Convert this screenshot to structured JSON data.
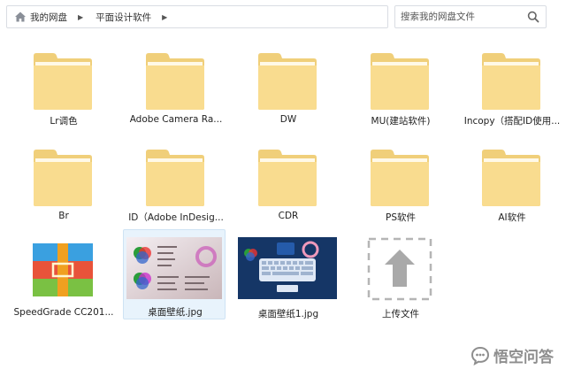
{
  "breadcrumb": {
    "home_icon": "home-icon",
    "items": [
      "我的网盘",
      "平面设计软件"
    ]
  },
  "search": {
    "placeholder": "搜索我的网盘文件",
    "icon": "search-icon"
  },
  "files": [
    {
      "name": "Lr调色",
      "type": "folder"
    },
    {
      "name": "Adobe Camera Ra...",
      "type": "folder"
    },
    {
      "name": "DW",
      "type": "folder"
    },
    {
      "name": "MU(建站软件)",
      "type": "folder"
    },
    {
      "name": "Incopy（搭配ID使用...",
      "type": "folder"
    },
    {
      "name": "Br",
      "type": "folder"
    },
    {
      "name": "ID（Adobe InDesig...",
      "type": "folder"
    },
    {
      "name": "CDR",
      "type": "folder"
    },
    {
      "name": "PS软件",
      "type": "folder"
    },
    {
      "name": "AI软件",
      "type": "folder"
    },
    {
      "name": "SpeedGrade CC201...",
      "type": "archive"
    },
    {
      "name": "桌面壁纸.jpg",
      "type": "image",
      "selected": true
    },
    {
      "name": "桌面壁纸1.jpg",
      "type": "image"
    },
    {
      "name": "上传文件",
      "type": "upload"
    }
  ],
  "watermark": {
    "text": "悟空问答",
    "icon": "chat-bubble-icon"
  },
  "colors": {
    "folder": "#f9dc8f",
    "folder_tab": "#f0cf7a",
    "selected_bg": "#e8f3fc"
  }
}
